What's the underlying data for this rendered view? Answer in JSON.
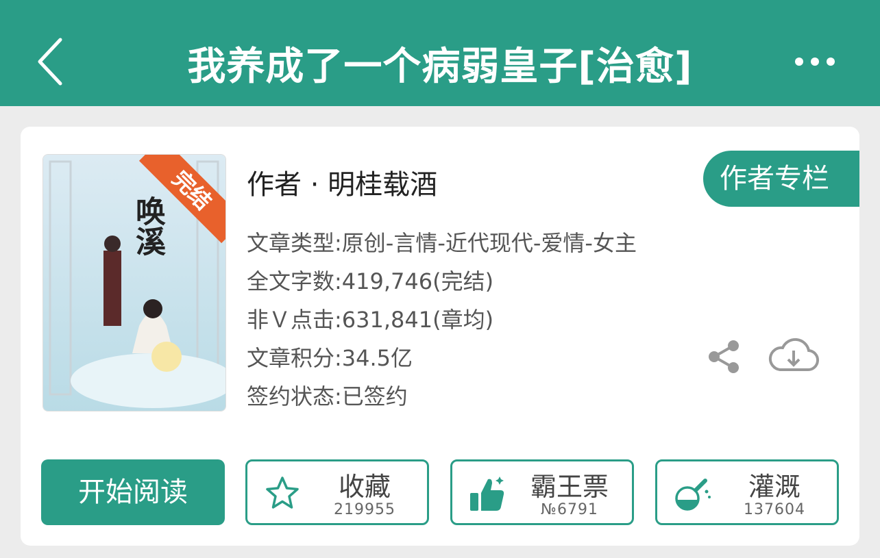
{
  "header": {
    "title": "我养成了一个病弱皇子[治愈]",
    "back_icon": "chevron-left-icon",
    "more_icon": "more-dots-icon"
  },
  "book": {
    "cover_title": "唤溪",
    "cover_badge": "完结",
    "author_line": "作者 · 明桂载酒",
    "author_column_label": "作者专栏",
    "meta": [
      "文章类型:原创-言情-近代现代-爱情-女主",
      "全文字数:419,746(完结)",
      "非Ｖ点击:631,841(章均)",
      "文章积分:34.5亿",
      "签约状态:已签约"
    ]
  },
  "actions": {
    "read_label": "开始阅读",
    "collect": {
      "label": "收藏",
      "count": "219955",
      "icon": "star-icon"
    },
    "vote": {
      "label": "霸王票",
      "count": "№6791",
      "icon": "thumbs-up-icon"
    },
    "water": {
      "label": "灌溉",
      "count": "137604",
      "icon": "flask-icon"
    }
  },
  "colors": {
    "accent": "#2a9d87",
    "badge": "#e8612c"
  }
}
